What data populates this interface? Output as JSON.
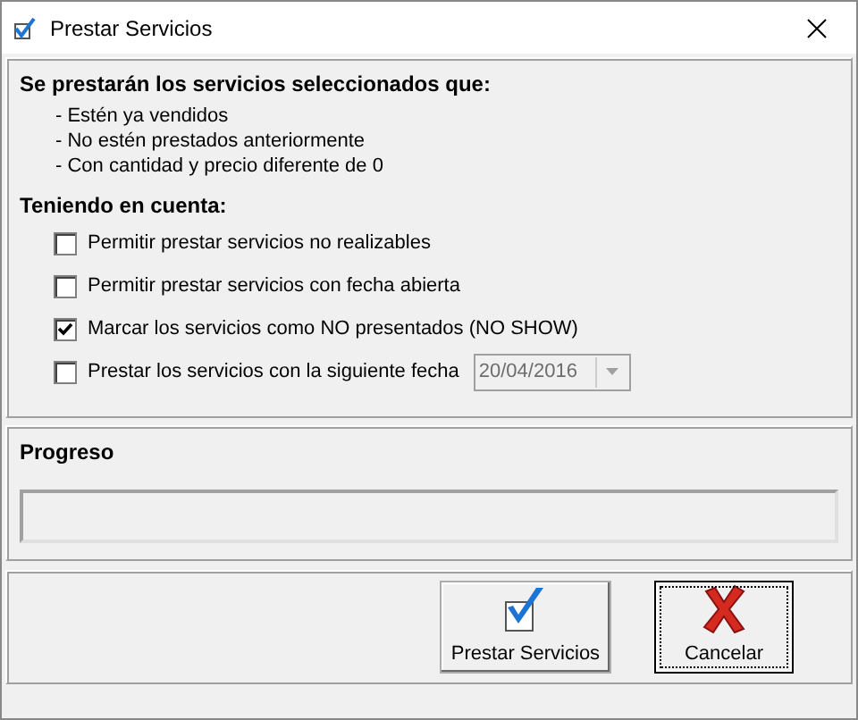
{
  "window": {
    "title": "Prestar Servicios"
  },
  "conditions": {
    "heading": "Se prestarán los servicios seleccionados que:",
    "items": [
      "- Estén ya vendidos",
      "- No estén prestados anteriormente",
      "- Con cantidad y precio diferente de 0"
    ]
  },
  "options": {
    "heading": "Teniendo en cuenta:",
    "items": [
      {
        "kind": "checkbox",
        "label": "Permitir prestar servicios no realizables",
        "checked": false
      },
      {
        "kind": "checkbox",
        "label": "Permitir prestar servicios con fecha abierta",
        "checked": false
      },
      {
        "kind": "checkbox",
        "label": "Marcar los servicios como NO presentados (NO SHOW)",
        "checked": true
      },
      {
        "kind": "checkbox-date",
        "label": "Prestar los servicios con la siguiente fecha",
        "checked": false,
        "date": {
          "value": "20/04/2016",
          "disabled": true
        }
      }
    ]
  },
  "progress": {
    "heading": "Progreso"
  },
  "buttons": [
    {
      "kind": "accept",
      "label": "Prestar Servicios",
      "focused": false
    },
    {
      "kind": "cancel",
      "label": "Cancelar",
      "focused": true
    }
  ]
}
